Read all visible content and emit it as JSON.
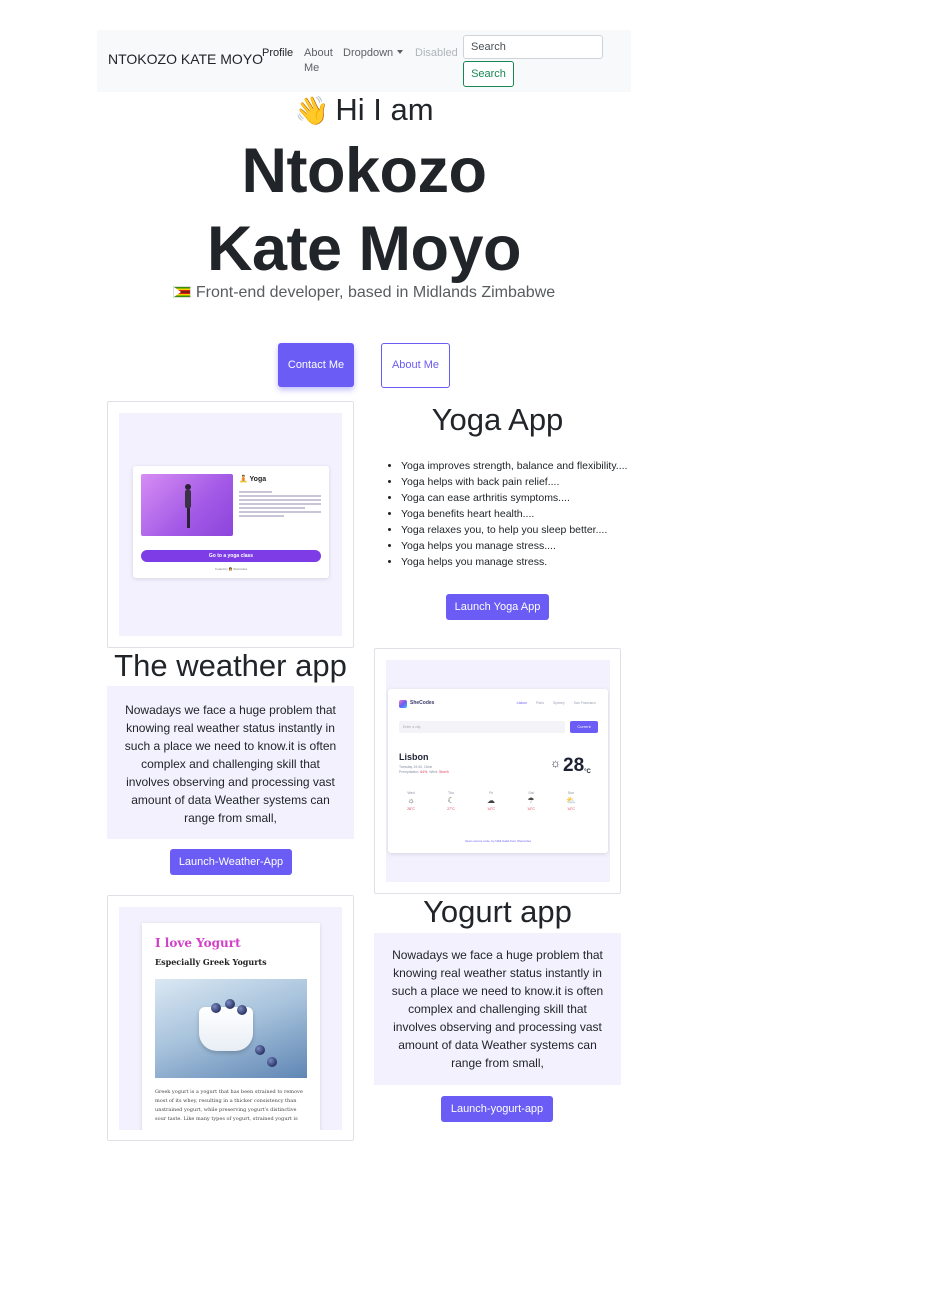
{
  "nav": {
    "brand": "NTOKOZO KATE MOYO",
    "profile": "Profile",
    "about": "About Me",
    "dropdown": "Dropdown",
    "disabled": "Disabled",
    "search_placeholder": "Search",
    "search_button": "Search"
  },
  "hero": {
    "greeting_emoji": "👋",
    "greeting": "Hi I am",
    "name": "Ntokozo Kate Moyo",
    "tagline": "Front-end developer, based in Midlands Zimbabwe",
    "contact_button": "Contact Me",
    "about_button": "About Me"
  },
  "yoga": {
    "title": "Yoga App",
    "bullets": [
      "Yoga improves strength, balance and flexibility....",
      "Yoga helps with back pain relief....",
      "Yoga can ease arthritis symptoms....",
      "Yoga benefits heart health....",
      "Yoga relaxes you, to help you sleep better....",
      "Yoga helps you manage stress....",
      "Yoga helps you manage stress."
    ],
    "button": "Launch Yoga App",
    "preview": {
      "title": "🧘 Yoga",
      "cta": "Go to a yoga class",
      "footer": "Coded by 👩 SheCodes"
    }
  },
  "weather": {
    "title": "The weather app",
    "description": "Nowadays we face a huge problem that knowing real weather status instantly in such a place we need to know.it is often complex and challenging skill that involves observing and processing vast amount of data Weather systems can range from small,",
    "button": "Launch-Weather-App",
    "preview": {
      "logo": "SheCodes",
      "nav": [
        "Lisbon",
        "Paris",
        "Sydney",
        "San Francisco"
      ],
      "search_placeholder": "Enter a city",
      "current_button": "Current",
      "city": "Lisbon",
      "meta_line1": "Tuesday 19:40, Clear",
      "meta_precip_label": "Precipitation:",
      "meta_precip": "64%",
      "meta_wind_label": "Wind:",
      "meta_wind": "5km/h",
      "temp": "28",
      "unit": "°C",
      "days": [
        {
          "day": "Wed",
          "icon": "☼",
          "temp": "28°C"
        },
        {
          "day": "Thu",
          "icon": "☾",
          "temp": "27°C"
        },
        {
          "day": "Fri",
          "icon": "☁",
          "temp": "14°C"
        },
        {
          "day": "Sat",
          "icon": "☂",
          "temp": "14°C"
        },
        {
          "day": "Sun",
          "icon": "⛅",
          "temp": "14°C"
        }
      ],
      "footer": "Open-source code, by Ndiil Gaba from SheCodes"
    }
  },
  "yogurt": {
    "title": "Yogurt app",
    "description": "Nowadays we face a huge problem that knowing real weather status instantly in such a place we need to know.it is often complex and challenging skill that involves observing and processing vast amount of data Weather systems can range from small,",
    "button": "Launch-yogurt-app",
    "preview": {
      "title": "I love Yogurt",
      "subtitle": "Especially Greek Yogurts",
      "text": "Greek yogurt is a yogurt that has been strained to remove most of its whey, resulting in a thicker consistency than unstrained yogurt, while preserving yogurt's distinctive sour taste. Like many types of yogurt, strained yogurt is"
    }
  },
  "colors": {
    "accent": "#6a5cf4",
    "success": "#198754",
    "panel": "#f3f1fe",
    "navbar": "#f8f9fa"
  }
}
